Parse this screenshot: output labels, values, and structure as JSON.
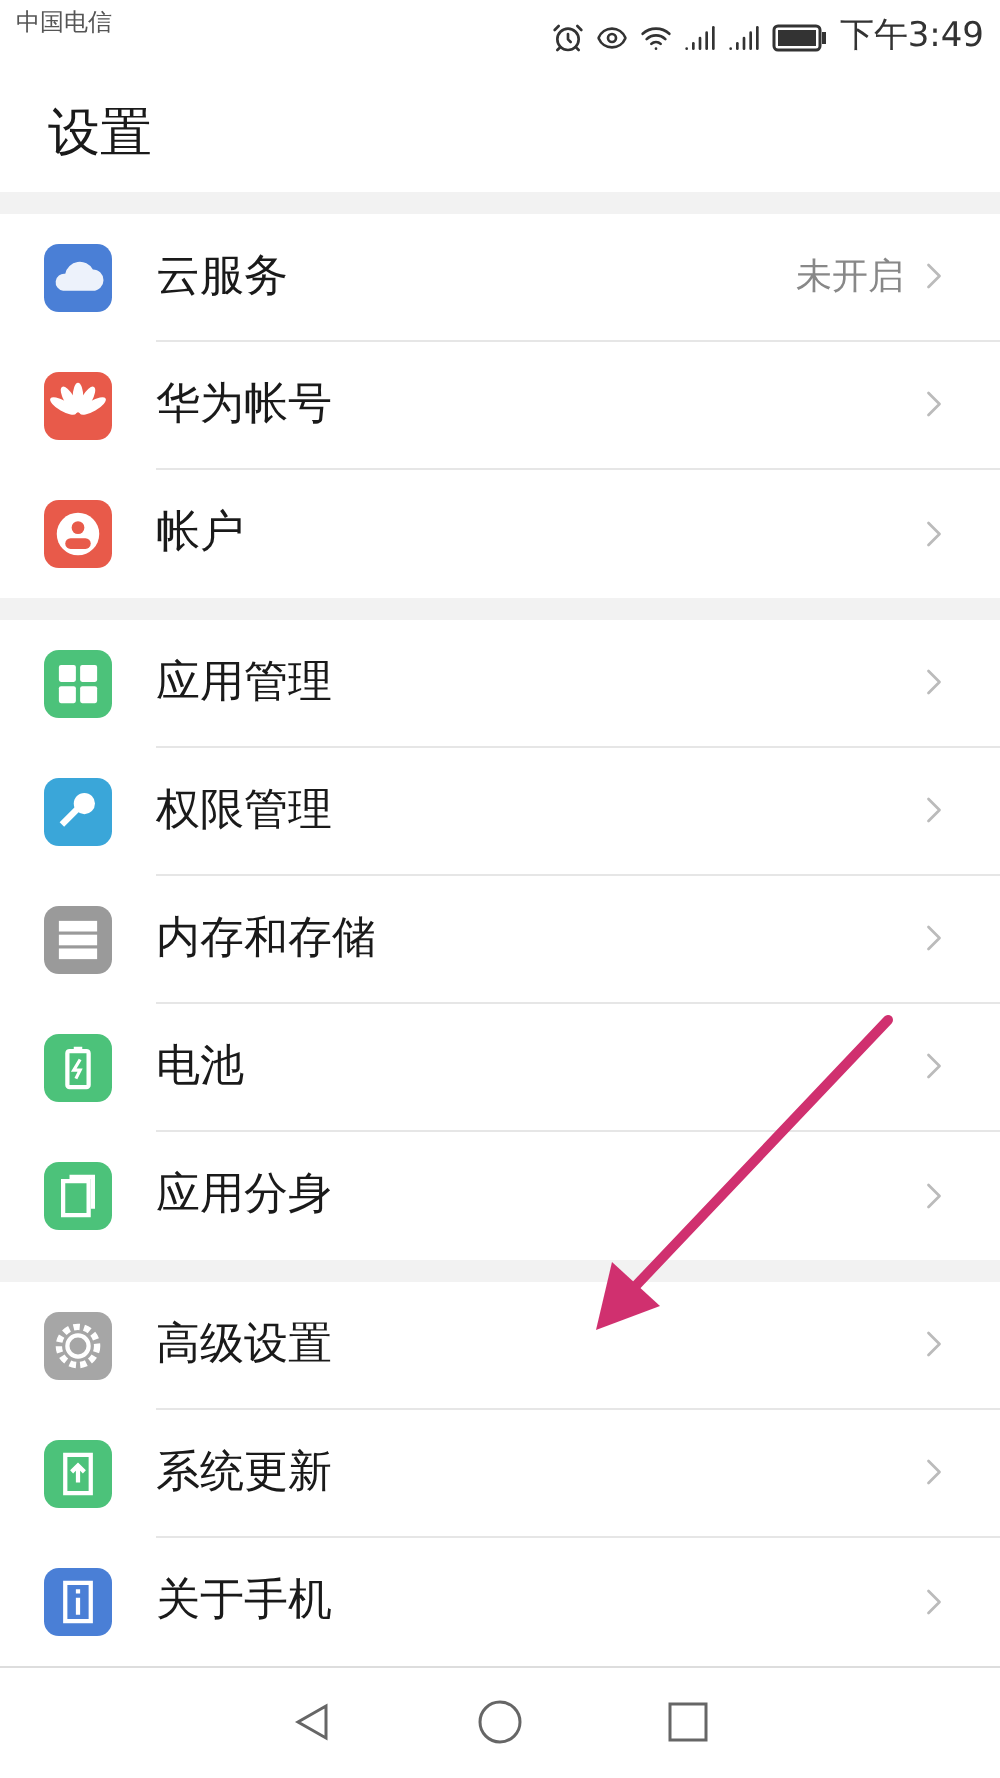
{
  "status_bar": {
    "carrier": "中国电信",
    "time": "下午3:49"
  },
  "title": "设置",
  "groups": [
    {
      "items": [
        {
          "kind": "cloud",
          "label": "云服务",
          "value": "未开启"
        },
        {
          "kind": "petals",
          "label": "华为帐号"
        },
        {
          "kind": "person",
          "label": "帐户"
        }
      ]
    },
    {
      "items": [
        {
          "kind": "grid",
          "label": "应用管理"
        },
        {
          "kind": "key",
          "label": "权限管理"
        },
        {
          "kind": "storage",
          "label": "内存和存储"
        },
        {
          "kind": "battery",
          "label": "电池"
        },
        {
          "kind": "twin",
          "label": "应用分身"
        }
      ]
    },
    {
      "items": [
        {
          "kind": "gear",
          "label": "高级设置"
        },
        {
          "kind": "update",
          "label": "系统更新"
        },
        {
          "kind": "info",
          "label": "关于手机"
        }
      ]
    }
  ],
  "annotation": {
    "kind": "arrow"
  }
}
